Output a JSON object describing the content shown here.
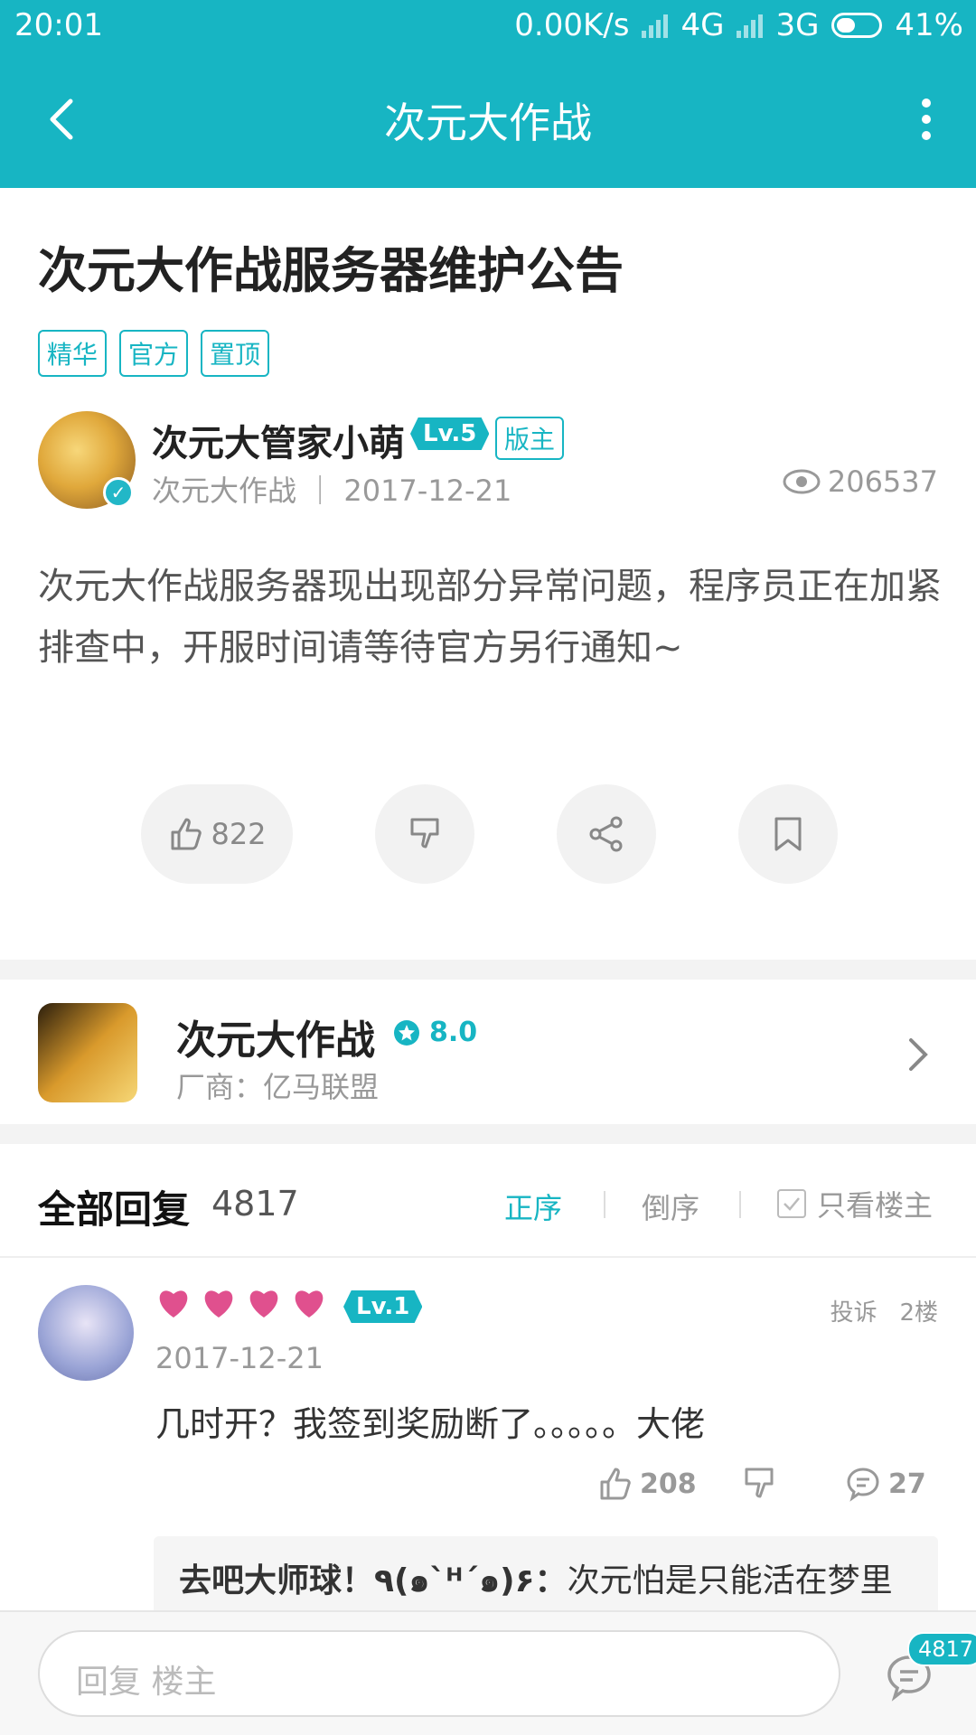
{
  "status_bar": {
    "time": "20:01",
    "speed": "0.00K/s",
    "net1": "4G",
    "net2": "3G",
    "battery": "41%"
  },
  "app_bar": {
    "title": "次元大作战"
  },
  "post": {
    "title": "次元大作战服务器维护公告",
    "tags": [
      "精华",
      "官方",
      "置顶"
    ],
    "author": {
      "name": "次元大管家小萌",
      "level": "Lv.5",
      "role": "版主",
      "meta": "次元大作战 ｜ 2017-12-21"
    },
    "views": "206537",
    "body": "次元大作战服务器现出现部分异常问题，程序员正在加紧排查中，开服时间请等待官方另行通知~",
    "likes": "822"
  },
  "game": {
    "name": "次元大作战",
    "rating": "8.0",
    "vendor": "厂商：亿马联盟"
  },
  "replies": {
    "title": "全部回复",
    "count": "4817",
    "sort_asc": "正序",
    "sort_desc": "倒序",
    "only_op": "只看楼主",
    "first": {
      "level": "Lv.1",
      "report": "投诉",
      "floor": "2楼",
      "date": "2017-12-21",
      "text": "几时开？我签到奖励断了。。。。。大佬",
      "likes": "208",
      "comments": "27",
      "sub_user": "去吧大师球！٩(๑`ᴴ´๑)۶：",
      "sub_text": "次元怕是只能活在梦里"
    }
  },
  "bottom": {
    "placeholder": "回复  楼主",
    "badge": "4817"
  },
  "colors": {
    "accent": "#17b5c3",
    "heart": "#e0508e"
  }
}
